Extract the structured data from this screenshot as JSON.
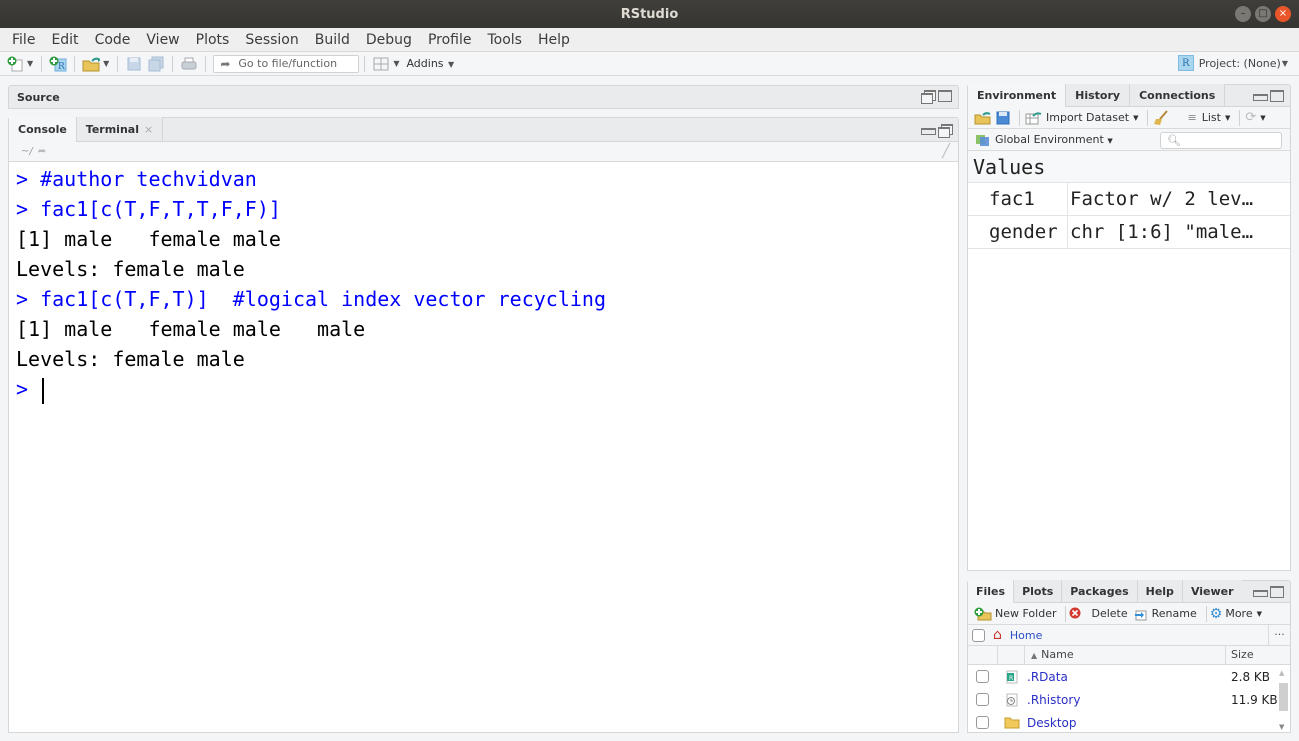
{
  "window": {
    "title": "RStudio"
  },
  "menu": [
    "File",
    "Edit",
    "Code",
    "View",
    "Plots",
    "Session",
    "Build",
    "Debug",
    "Profile",
    "Tools",
    "Help"
  ],
  "toolbar": {
    "goto_placeholder": "Go to file/function",
    "addins_label": "Addins",
    "project_label": "Project: (None)"
  },
  "source": {
    "title": "Source"
  },
  "console_pane": {
    "tabs": [
      {
        "label": "Console"
      },
      {
        "label": "Terminal"
      }
    ],
    "working_dir": "~/",
    "lines": [
      {
        "type": "in",
        "text": "> #author techvidvan"
      },
      {
        "type": "in",
        "text": "> fac1[c(T,F,T,T,F,F)]"
      },
      {
        "type": "out",
        "text": "[1] male   female male"
      },
      {
        "type": "out",
        "text": "Levels: female male"
      },
      {
        "type": "in",
        "text": "> fac1[c(T,F,T)]  #logical index vector recycling"
      },
      {
        "type": "out",
        "text": "[1] male   female male   male"
      },
      {
        "type": "out",
        "text": "Levels: female male"
      }
    ],
    "prompt": ">"
  },
  "environment": {
    "tabs": [
      {
        "label": "Environment"
      },
      {
        "label": "History"
      },
      {
        "label": "Connections"
      }
    ],
    "import_label": "Import Dataset",
    "view_label": "List",
    "scope_label": "Global Environment",
    "section_title": "Values",
    "rows": [
      {
        "name": "fac1",
        "value": "Factor w/ 2 lev…"
      },
      {
        "name": "gender",
        "value": "chr [1:6] \"male…"
      }
    ]
  },
  "files": {
    "tabs": [
      {
        "label": "Files"
      },
      {
        "label": "Plots"
      },
      {
        "label": "Packages"
      },
      {
        "label": "Help"
      },
      {
        "label": "Viewer"
      }
    ],
    "toolbar": {
      "new_folder": "New Folder",
      "delete": "Delete",
      "rename": "Rename",
      "more": "More"
    },
    "path": "Home",
    "more_path": "...",
    "columns": {
      "name": "Name",
      "size": "Size"
    },
    "rows": [
      {
        "name": ".RData",
        "size": "2.8 KB",
        "icon": "rdata-file-icon"
      },
      {
        "name": ".Rhistory",
        "size": "11.9 KB",
        "icon": "history-file-icon"
      },
      {
        "name": "Desktop",
        "size": "",
        "icon": "folder-icon"
      }
    ]
  }
}
